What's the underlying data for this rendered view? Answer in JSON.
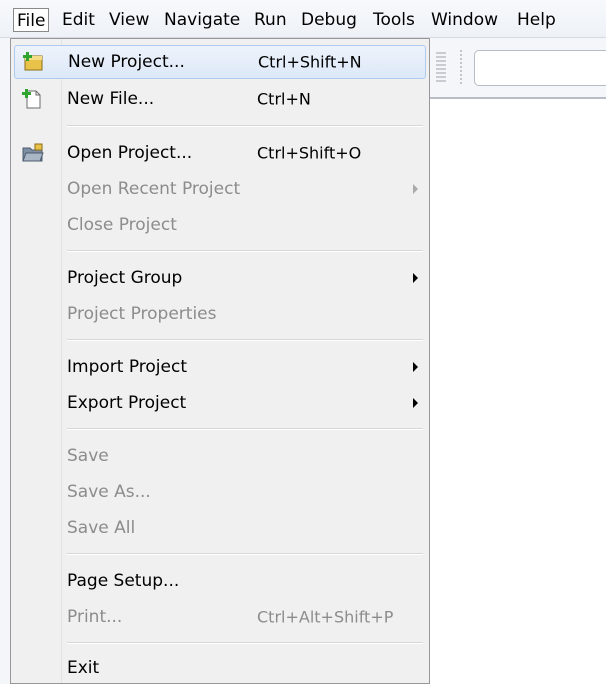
{
  "menubar": {
    "items": [
      "File",
      "Edit",
      "View",
      "Navigate",
      "Run",
      "Debug",
      "Tools",
      "Window",
      "Help"
    ],
    "active": "File"
  },
  "file_menu": {
    "items": [
      {
        "label": "New Project...",
        "shortcut": "Ctrl+Shift+N",
        "enabled": true,
        "icon": "new-project-icon"
      },
      {
        "label": "New File...",
        "shortcut": "Ctrl+N",
        "enabled": true,
        "icon": "new-file-icon"
      },
      {
        "label": "Open Project...",
        "shortcut": "Ctrl+Shift+O",
        "enabled": true,
        "icon": "open-project-icon"
      },
      {
        "label": "Open Recent Project",
        "shortcut": "",
        "enabled": false,
        "submenu": true
      },
      {
        "label": "Close Project",
        "shortcut": "",
        "enabled": false
      },
      {
        "label": "Project Group",
        "shortcut": "",
        "enabled": true,
        "submenu": true
      },
      {
        "label": "Project Properties",
        "shortcut": "",
        "enabled": false
      },
      {
        "label": "Import Project",
        "shortcut": "",
        "enabled": true,
        "submenu": true
      },
      {
        "label": "Export Project",
        "shortcut": "",
        "enabled": true,
        "submenu": true
      },
      {
        "label": "Save",
        "shortcut": "",
        "enabled": false
      },
      {
        "label": "Save As...",
        "shortcut": "",
        "enabled": false
      },
      {
        "label": "Save All",
        "shortcut": "",
        "enabled": false
      },
      {
        "label": "Page Setup...",
        "shortcut": "",
        "enabled": true
      },
      {
        "label": "Print...",
        "shortcut": "Ctrl+Alt+Shift+P",
        "enabled": false
      },
      {
        "label": "Exit",
        "shortcut": "",
        "enabled": true
      }
    ]
  },
  "colors": {
    "highlight": "#dce8f8",
    "disabled_text": "#8c8c8c",
    "menu_background": "#f0f0f0"
  }
}
